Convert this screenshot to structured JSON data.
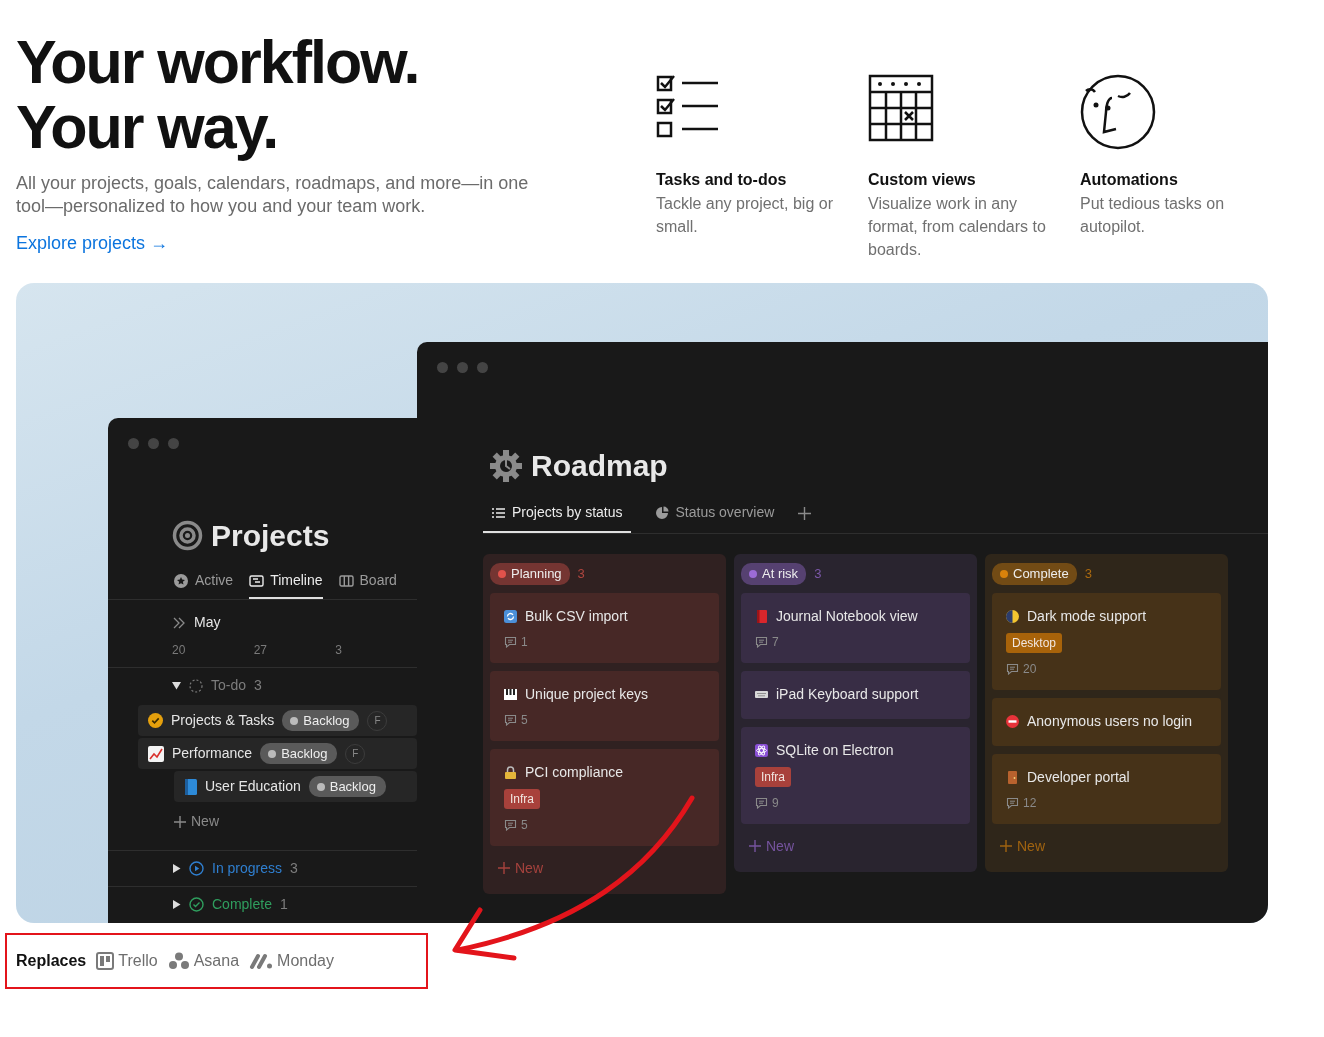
{
  "hero": {
    "headline_lines": [
      "Your workflow.",
      "Your way."
    ],
    "subtitle": "All your projects, goals, calendars, roadmaps, and more—in one tool—personalized to how you and your team work.",
    "link": "Explore projects →"
  },
  "features": [
    {
      "title": "Tasks and to-dos",
      "description": "Tackle any project, big or small."
    },
    {
      "title": "Custom views",
      "description": "Visualize work in any format, from calendars to boards."
    },
    {
      "title": "Automations",
      "description": "Put tedious tasks on autopilot."
    }
  ],
  "projects_window": {
    "title": "Projects",
    "tabs": [
      {
        "label": "Active",
        "selected": false
      },
      {
        "label": "Timeline",
        "selected": true
      },
      {
        "label": "Board",
        "selected": false
      }
    ],
    "timeline": {
      "month": "May",
      "dates": [
        "20",
        "27",
        "3"
      ]
    },
    "groups": [
      {
        "label": "To-do",
        "count": "3",
        "kind": "todo",
        "color": "#7d7d7d",
        "expanded": true,
        "items": [
          {
            "title": "Projects & Tasks",
            "status": "Backlog",
            "assignee": "F"
          },
          {
            "title": "Performance",
            "status": "Backlog",
            "assignee": "F"
          },
          {
            "title": "User Education",
            "status": "Backlog"
          }
        ],
        "new_label": "New"
      },
      {
        "label": "In progress",
        "count": "3",
        "kind": "progress",
        "color": "#2f7fd0",
        "expanded": false
      },
      {
        "label": "Complete",
        "count": "1",
        "kind": "done",
        "color": "#2f9e5e",
        "expanded": false
      }
    ]
  },
  "roadmap_window": {
    "title": "Roadmap",
    "tabs": [
      {
        "label": "Projects by status",
        "selected": true
      },
      {
        "label": "Status overview",
        "selected": false
      }
    ],
    "columns": [
      {
        "status": "Planning",
        "count": "3",
        "color": "#e0524b",
        "new_label": "New",
        "cards": [
          {
            "title": "Bulk CSV import",
            "comments": "1"
          },
          {
            "title": "Unique project keys",
            "comments": "5"
          },
          {
            "title": "PCI compliance",
            "tag": {
              "label": "Infra",
              "color": "#a8413b"
            },
            "comments": "5"
          }
        ]
      },
      {
        "status": "At risk",
        "count": "3",
        "color": "#9b6bd6",
        "new_label": "New",
        "cards": [
          {
            "title": "Journal Notebook view",
            "comments": "7"
          },
          {
            "title": "iPad Keyboard support"
          },
          {
            "title": "SQLite on Electron",
            "tag": {
              "label": "Infra",
              "color": "#a8413b"
            },
            "comments": "9"
          }
        ]
      },
      {
        "status": "Complete",
        "count": "3",
        "color": "#d9820b",
        "new_label": "New",
        "cards": [
          {
            "title": "Dark mode support",
            "tag": {
              "label": "Desktop",
              "color": "#a8630a"
            },
            "comments": "20"
          },
          {
            "title": "Anonymous users no login"
          },
          {
            "title": "Developer portal",
            "comments": "12"
          }
        ]
      }
    ]
  },
  "replaces": {
    "label": "Replaces",
    "apps": [
      "Trello",
      "Asana",
      "Monday"
    ]
  }
}
